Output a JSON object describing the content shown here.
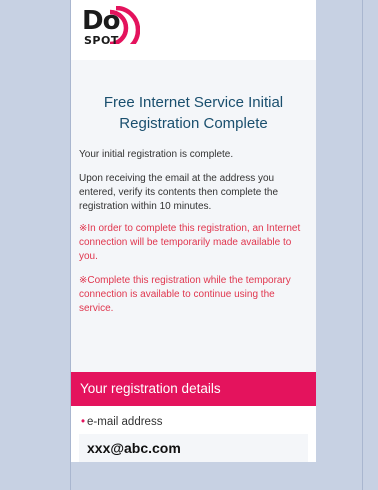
{
  "brand": {
    "logo_main": "Do",
    "logo_sub": "SPOT",
    "logo_color": "#e4135d",
    "logo_name": "dospot-logo"
  },
  "main": {
    "title": "Free Internet Service Initial Registration Complete",
    "paragraph1": "Your initial registration is complete.",
    "paragraph2": "Upon receiving the email at the address you entered, verify its contents then complete the registration within 10 minutes.",
    "note1": "※In order to complete this registration, an Internet connection will be temporarily made available to you.",
    "note2": "※Complete this registration while the temporary connection is available to continue using the service."
  },
  "details": {
    "heading": "Your registration details",
    "required_mark": "•",
    "email_label": "e-mail address",
    "email_value": "xxx@abc.com"
  },
  "colors": {
    "accent": "#e4135d",
    "title": "#1a4f6e",
    "note": "#e0364e",
    "background": "#c7d1e3"
  }
}
